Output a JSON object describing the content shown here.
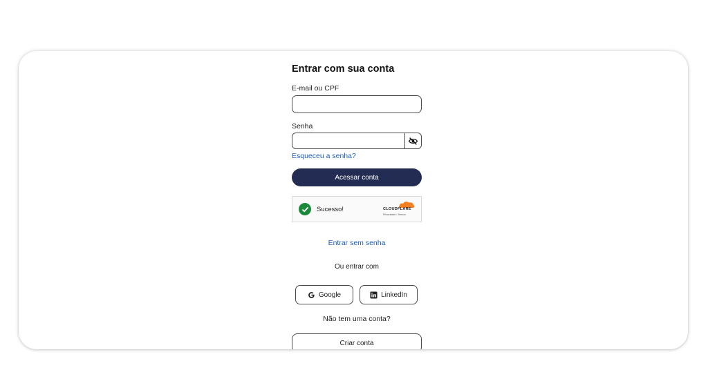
{
  "login": {
    "title": "Entrar com sua conta",
    "email_label": "E-mail ou CPF",
    "email_value": "",
    "password_label": "Senha",
    "password_value": "",
    "forgot_link": "Esqueceu a senha?",
    "submit_label": "Acessar conta"
  },
  "captcha": {
    "status": "Sucesso!",
    "brand": "CLOUDFLARE",
    "brand_sub": "Privacidade  •  Termos",
    "icon": "check-circle-icon",
    "status_color": "#1b8a3a"
  },
  "alt_login": {
    "passwordless_link": "Entrar sem senha",
    "or_text": "Ou entrar com",
    "google_label": "Google",
    "linkedin_label": "LinkedIn"
  },
  "signup": {
    "prompt": "Não tem uma conta?",
    "button_label": "Criar conta"
  },
  "colors": {
    "primary": "#232c52",
    "link": "#1d5fbf"
  }
}
